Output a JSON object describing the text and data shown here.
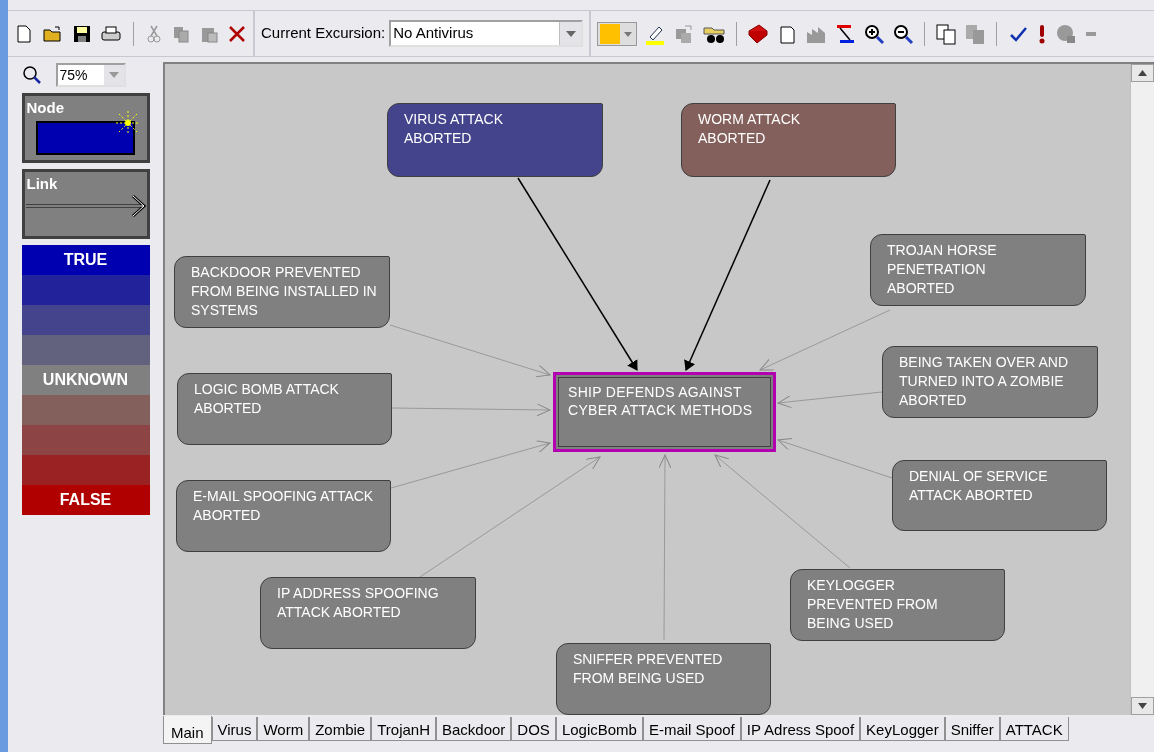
{
  "toolbar": {
    "excursion_label": "Current Excursion:",
    "excursion_value": "No Antivirus"
  },
  "zoom": {
    "value": "75%"
  },
  "palette": [
    {
      "label": "Node"
    },
    {
      "label": "Link"
    }
  ],
  "legend": [
    {
      "label": "TRUE",
      "color": "#0000b0"
    },
    {
      "color": "#22229a"
    },
    {
      "color": "#44448c"
    },
    {
      "color": "#62627e"
    },
    {
      "label": "UNKNOWN",
      "color": "#808080"
    },
    {
      "color": "#84605c"
    },
    {
      "color": "#8c4444"
    },
    {
      "color": "#9a2222"
    },
    {
      "label": "FALSE",
      "color": "#b00000"
    }
  ],
  "diagram": {
    "center": {
      "text": "SHIP DEFENDS AGAINST CYBER ATTACK METHODS",
      "selected": true,
      "color": "#808080"
    },
    "nodes": [
      {
        "text": "VIRUS ATTACK ABORTED",
        "color": "#44448c",
        "strong_link": true
      },
      {
        "text": "WORM ATTACK ABORTED",
        "color": "#84605c",
        "strong_link": true
      },
      {
        "text": "TROJAN HORSE PENETRATION ABORTED",
        "color": "#808080",
        "strong_link": false
      },
      {
        "text": "BACKDOOR PREVENTED FROM BEING INSTALLED IN SYSTEMS",
        "color": "#808080",
        "strong_link": false
      },
      {
        "text": "BEING TAKEN OVER AND TURNED INTO A ZOMBIE ABORTED",
        "color": "#808080",
        "strong_link": false
      },
      {
        "text": "LOGIC BOMB ATTACK ABORTED",
        "color": "#808080",
        "strong_link": false
      },
      {
        "text": "DENIAL OF SERVICE ATTACK ABORTED",
        "color": "#808080",
        "strong_link": false
      },
      {
        "text": "E-MAIL SPOOFING ATTACK ABORTED",
        "color": "#808080",
        "strong_link": false
      },
      {
        "text": "IP ADDRESS SPOOFING ATTACK ABORTED",
        "color": "#808080",
        "strong_link": false
      },
      {
        "text": "KEYLOGGER PREVENTED FROM BEING USED",
        "color": "#808080",
        "strong_link": false
      },
      {
        "text": "SNIFFER PREVENTED FROM BEING USED",
        "color": "#808080",
        "strong_link": false
      }
    ]
  },
  "tabs": [
    {
      "label": "Main",
      "selected": true
    },
    {
      "label": "Virus",
      "selected": false
    },
    {
      "label": "Worm",
      "selected": false
    },
    {
      "label": "Zombie",
      "selected": false
    },
    {
      "label": "TrojanH",
      "selected": false
    },
    {
      "label": "Backdoor",
      "selected": false
    },
    {
      "label": "DOS",
      "selected": false
    },
    {
      "label": "LogicBomb",
      "selected": false
    },
    {
      "label": "E-mail Spoof",
      "selected": false
    },
    {
      "label": "IP Adress Spoof",
      "selected": false
    },
    {
      "label": "KeyLogger",
      "selected": false
    },
    {
      "label": "Sniffer",
      "selected": false
    },
    {
      "label": "ATTACK",
      "selected": false
    }
  ]
}
